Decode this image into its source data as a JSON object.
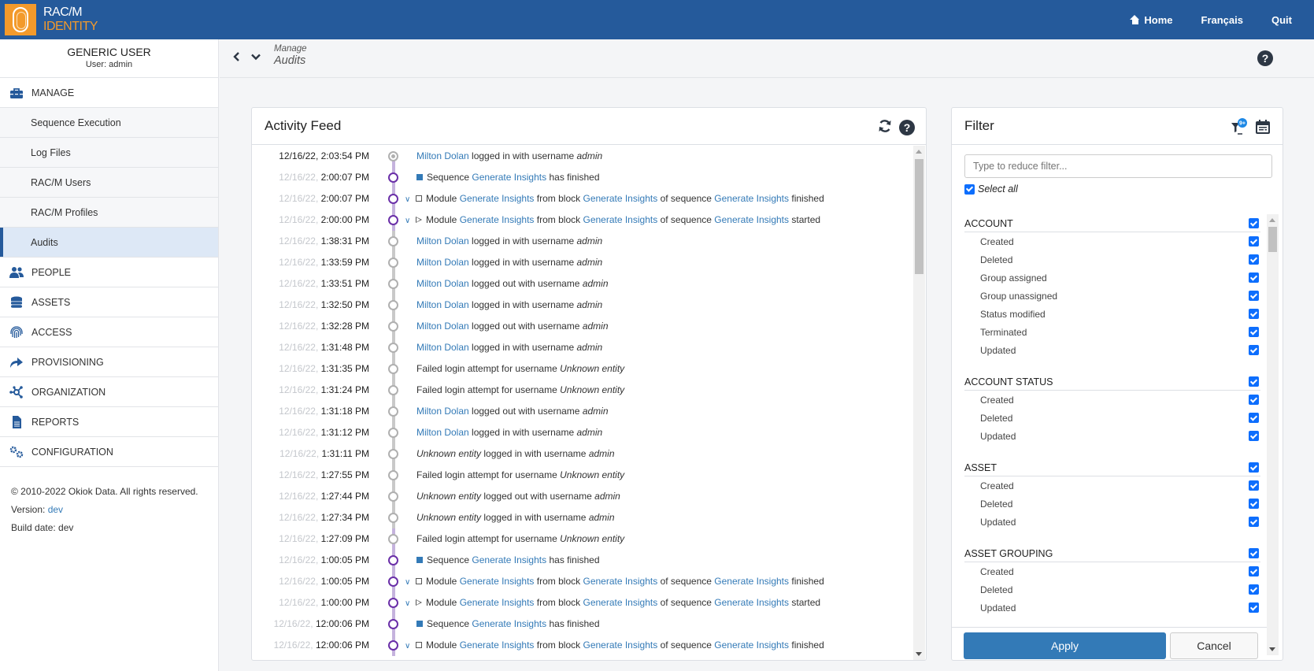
{
  "header": {
    "logo_line1": "RAC/M",
    "logo_line2": "IDENTITY",
    "nav": [
      {
        "label": "Home",
        "icon": "home-icon"
      },
      {
        "label": "Français"
      },
      {
        "label": "Quit"
      }
    ]
  },
  "user": {
    "name": "GENERIC USER",
    "sub": "User: admin"
  },
  "sidebar": {
    "items": [
      {
        "label": "MANAGE",
        "icon": "toolbox-icon",
        "type": "section"
      },
      {
        "label": "Sequence Execution",
        "type": "sub"
      },
      {
        "label": "Log Files",
        "type": "sub"
      },
      {
        "label": "RAC/M Users",
        "type": "sub"
      },
      {
        "label": "RAC/M Profiles",
        "type": "sub"
      },
      {
        "label": "Audits",
        "type": "sub",
        "active": true
      },
      {
        "label": "PEOPLE",
        "icon": "people-icon",
        "type": "section"
      },
      {
        "label": "ASSETS",
        "icon": "database-icon",
        "type": "section"
      },
      {
        "label": "ACCESS",
        "icon": "fingerprint-icon",
        "type": "section"
      },
      {
        "label": "PROVISIONING",
        "icon": "share-arrow-icon",
        "type": "section"
      },
      {
        "label": "ORGANIZATION",
        "icon": "network-icon",
        "type": "section"
      },
      {
        "label": "REPORTS",
        "icon": "document-icon",
        "type": "section"
      },
      {
        "label": "CONFIGURATION",
        "icon": "gears-icon",
        "type": "section"
      }
    ],
    "footer": {
      "copyright": "© 2010-2022 Okiok Data. All rights reserved.",
      "version_label": "Version: ",
      "version_value": "dev",
      "build_label": "Build date: dev"
    }
  },
  "breadcrumb": {
    "parent": "Manage",
    "current": "Audits"
  },
  "activity_feed": {
    "title": "Activity Feed",
    "rows": [
      {
        "date": "12/16/22,",
        "time": "2:03:54 PM",
        "kind": "user",
        "node": "dot",
        "user": "Milton Dolan",
        "action": "logged in with username",
        "username": "admin"
      },
      {
        "date": "12/16/22,",
        "time": "2:00:07 PM",
        "kind": "seq",
        "node": "purple",
        "prefix": "Sequence",
        "name": "Generate Insights",
        "suffix": "has finished"
      },
      {
        "date": "12/16/22,",
        "time": "2:00:07 PM",
        "kind": "mod",
        "node": "purple",
        "status_icon": "square-empty",
        "prefix": "Module",
        "module": "Generate Insights",
        "from": "from block",
        "block": "Generate Insights",
        "of": "of sequence",
        "sequence": "Generate Insights",
        "suffix": "finished"
      },
      {
        "date": "12/16/22,",
        "time": "2:00:00 PM",
        "kind": "mod",
        "node": "purple",
        "status_icon": "play-outline",
        "prefix": "Module",
        "module": "Generate Insights",
        "from": "from block",
        "block": "Generate Insights",
        "of": "of sequence",
        "sequence": "Generate Insights",
        "suffix": "started"
      },
      {
        "date": "12/16/22,",
        "time": "1:38:31 PM",
        "kind": "user",
        "node": "grey",
        "user": "Milton Dolan",
        "action": "logged in with username",
        "username": "admin"
      },
      {
        "date": "12/16/22,",
        "time": "1:33:59 PM",
        "kind": "user",
        "node": "grey",
        "user": "Milton Dolan",
        "action": "logged in with username",
        "username": "admin"
      },
      {
        "date": "12/16/22,",
        "time": "1:33:51 PM",
        "kind": "user",
        "node": "grey",
        "user": "Milton Dolan",
        "action": "logged out with username",
        "username": "admin"
      },
      {
        "date": "12/16/22,",
        "time": "1:32:50 PM",
        "kind": "user",
        "node": "grey",
        "user": "Milton Dolan",
        "action": "logged in with username",
        "username": "admin"
      },
      {
        "date": "12/16/22,",
        "time": "1:32:28 PM",
        "kind": "user",
        "node": "grey",
        "user": "Milton Dolan",
        "action": "logged out with username",
        "username": "admin"
      },
      {
        "date": "12/16/22,",
        "time": "1:31:48 PM",
        "kind": "user",
        "node": "grey",
        "user": "Milton Dolan",
        "action": "logged in with username",
        "username": "admin"
      },
      {
        "date": "12/16/22,",
        "time": "1:31:35 PM",
        "kind": "fail",
        "node": "grey",
        "action": "Failed login attempt for username",
        "username": "Unknown entity"
      },
      {
        "date": "12/16/22,",
        "time": "1:31:24 PM",
        "kind": "fail",
        "node": "grey",
        "action": "Failed login attempt for username",
        "username": "Unknown entity"
      },
      {
        "date": "12/16/22,",
        "time": "1:31:18 PM",
        "kind": "user",
        "node": "grey",
        "user": "Milton Dolan",
        "action": "logged out with username",
        "username": "admin"
      },
      {
        "date": "12/16/22,",
        "time": "1:31:12 PM",
        "kind": "user",
        "node": "grey",
        "user": "Milton Dolan",
        "action": "logged in with username",
        "username": "admin"
      },
      {
        "date": "12/16/22,",
        "time": "1:31:11 PM",
        "kind": "unknown",
        "node": "grey",
        "user": "Unknown entity",
        "action": "logged in with username",
        "username": "admin"
      },
      {
        "date": "12/16/22,",
        "time": "1:27:55 PM",
        "kind": "fail",
        "node": "grey",
        "action": "Failed login attempt for username",
        "username": "Unknown entity"
      },
      {
        "date": "12/16/22,",
        "time": "1:27:44 PM",
        "kind": "unknown",
        "node": "grey",
        "user": "Unknown entity",
        "action": "logged out with username",
        "username": "admin"
      },
      {
        "date": "12/16/22,",
        "time": "1:27:34 PM",
        "kind": "unknown",
        "node": "grey",
        "user": "Unknown entity",
        "action": "logged in with username",
        "username": "admin"
      },
      {
        "date": "12/16/22,",
        "time": "1:27:09 PM",
        "kind": "fail",
        "node": "grey",
        "action": "Failed login attempt for username",
        "username": "Unknown entity"
      },
      {
        "date": "12/16/22,",
        "time": "1:00:05 PM",
        "kind": "seq",
        "node": "purple",
        "prefix": "Sequence",
        "name": "Generate Insights",
        "suffix": "has finished"
      },
      {
        "date": "12/16/22,",
        "time": "1:00:05 PM",
        "kind": "mod",
        "node": "purple",
        "status_icon": "square-empty",
        "prefix": "Module",
        "module": "Generate Insights",
        "from": "from block",
        "block": "Generate Insights",
        "of": "of sequence",
        "sequence": "Generate Insights",
        "suffix": "finished"
      },
      {
        "date": "12/16/22,",
        "time": "1:00:00 PM",
        "kind": "mod",
        "node": "purple",
        "status_icon": "play-outline",
        "prefix": "Module",
        "module": "Generate Insights",
        "from": "from block",
        "block": "Generate Insights",
        "of": "of sequence",
        "sequence": "Generate Insights",
        "suffix": "started"
      },
      {
        "date": "12/16/22,",
        "time": "12:00:06 PM",
        "kind": "seq",
        "node": "purple",
        "prefix": "Sequence",
        "name": "Generate Insights",
        "suffix": "has finished"
      },
      {
        "date": "12/16/22,",
        "time": "12:00:06 PM",
        "kind": "mod",
        "node": "purple",
        "status_icon": "square-empty",
        "prefix": "Module",
        "module": "Generate Insights",
        "from": "from block",
        "block": "Generate Insights",
        "of": "of sequence",
        "sequence": "Generate Insights",
        "suffix": "finished"
      }
    ]
  },
  "filter": {
    "title": "Filter",
    "badge": "9+",
    "search_placeholder": "Type to reduce filter...",
    "search_value": "",
    "select_all_label": "Select all",
    "select_all_checked": true,
    "groups": [
      {
        "label": "ACCOUNT",
        "checked": true,
        "items": [
          {
            "label": "Created",
            "checked": true
          },
          {
            "label": "Deleted",
            "checked": true
          },
          {
            "label": "Group assigned",
            "checked": true
          },
          {
            "label": "Group unassigned",
            "checked": true
          },
          {
            "label": "Status modified",
            "checked": true
          },
          {
            "label": "Terminated",
            "checked": true
          },
          {
            "label": "Updated",
            "checked": true
          }
        ]
      },
      {
        "label": "ACCOUNT STATUS",
        "checked": true,
        "items": [
          {
            "label": "Created",
            "checked": true
          },
          {
            "label": "Deleted",
            "checked": true
          },
          {
            "label": "Updated",
            "checked": true
          }
        ]
      },
      {
        "label": "ASSET",
        "checked": true,
        "items": [
          {
            "label": "Created",
            "checked": true
          },
          {
            "label": "Deleted",
            "checked": true
          },
          {
            "label": "Updated",
            "checked": true
          }
        ]
      },
      {
        "label": "ASSET GROUPING",
        "checked": true,
        "items": [
          {
            "label": "Created",
            "checked": true
          },
          {
            "label": "Deleted",
            "checked": true
          },
          {
            "label": "Updated",
            "checked": true
          }
        ]
      }
    ],
    "apply_label": "Apply",
    "cancel_label": "Cancel"
  },
  "colors": {
    "brand_blue": "#255a9b",
    "brand_orange": "#f39a2b",
    "link": "#337ab7",
    "timeline_purple": "#6a2fa8",
    "checkbox": "#0d6efd"
  }
}
